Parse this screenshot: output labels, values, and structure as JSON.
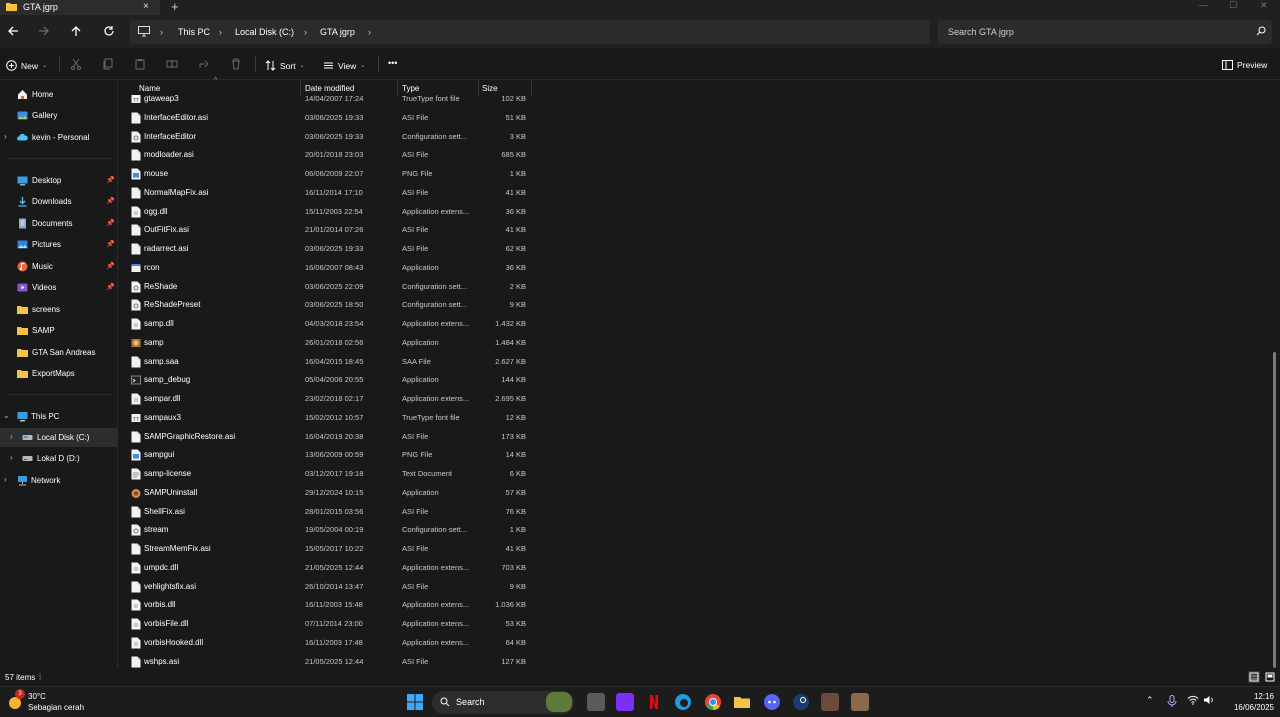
{
  "tab": {
    "title": "GTA jgrp",
    "close_glyph": "×",
    "new_tab_glyph": "+"
  },
  "window_controls": {
    "minimize": "—",
    "maximize": "☐",
    "close": "✕"
  },
  "breadcrumb": [
    "This PC",
    "Local Disk (C:)",
    "GTA jgrp"
  ],
  "search": {
    "placeholder": "Search GTA jgrp"
  },
  "commands": {
    "new": "New",
    "sort": "Sort",
    "view": "View",
    "more": "•••",
    "preview": "Preview"
  },
  "sidebar": {
    "quick": [
      {
        "label": "Home",
        "icon": "home-icon"
      },
      {
        "label": "Gallery",
        "icon": "gallery-icon"
      },
      {
        "label": "kevin - Personal",
        "icon": "onedrive-icon"
      }
    ],
    "pinned": [
      {
        "label": "Desktop",
        "icon": "desktop-folder-icon",
        "pinned": true
      },
      {
        "label": "Downloads",
        "icon": "downloads-icon",
        "pinned": true
      },
      {
        "label": "Documents",
        "icon": "documents-icon",
        "pinned": true
      },
      {
        "label": "Pictures",
        "icon": "pictures-icon",
        "pinned": true
      },
      {
        "label": "Music",
        "icon": "music-icon",
        "pinned": true
      },
      {
        "label": "Videos",
        "icon": "videos-icon",
        "pinned": true
      },
      {
        "label": "screens",
        "icon": "folder-icon",
        "pinned": false
      },
      {
        "label": "SAMP",
        "icon": "folder-icon",
        "pinned": false
      },
      {
        "label": "GTA San Andreas",
        "icon": "folder-icon",
        "pinned": false
      },
      {
        "label": "ExportMaps",
        "icon": "folder-icon",
        "pinned": false
      }
    ],
    "tree": [
      {
        "label": "This PC",
        "icon": "pc-icon",
        "expanded": true
      },
      {
        "label": "Local Disk (C:)",
        "icon": "drive-icon",
        "selected": true
      },
      {
        "label": "Lokal D (D:)",
        "icon": "drive-icon"
      },
      {
        "label": "Network",
        "icon": "network-icon"
      }
    ]
  },
  "columns": {
    "name": "Name",
    "date": "Date modified",
    "type": "Type",
    "size": "Size"
  },
  "files": [
    {
      "name": "gtaweap3",
      "date": "14/04/2007 17:24",
      "type": "TrueType font file",
      "size": "102 KB",
      "icon": "font-file-icon"
    },
    {
      "name": "InterfaceEditor.asi",
      "date": "03/06/2025 19:33",
      "type": "ASI File",
      "size": "51 KB",
      "icon": "file-icon"
    },
    {
      "name": "InterfaceEditor",
      "date": "03/06/2025 19:33",
      "type": "Configuration sett...",
      "size": "3 KB",
      "icon": "config-file-icon"
    },
    {
      "name": "modloader.asi",
      "date": "20/01/2018 23:03",
      "type": "ASI File",
      "size": "685 KB",
      "icon": "file-icon"
    },
    {
      "name": "mouse",
      "date": "06/06/2009 22:07",
      "type": "PNG File",
      "size": "1 KB",
      "icon": "image-file-icon"
    },
    {
      "name": "NormalMapFix.asi",
      "date": "16/11/2014 17:10",
      "type": "ASI File",
      "size": "41 KB",
      "icon": "file-icon"
    },
    {
      "name": "ogg.dll",
      "date": "15/11/2003 22:54",
      "type": "Application extens...",
      "size": "36 KB",
      "icon": "dll-file-icon"
    },
    {
      "name": "OutFitFix.asi",
      "date": "21/01/2014 07:26",
      "type": "ASI File",
      "size": "41 KB",
      "icon": "file-icon"
    },
    {
      "name": "radarrect.asi",
      "date": "03/06/2025 19:33",
      "type": "ASI File",
      "size": "62 KB",
      "icon": "file-icon"
    },
    {
      "name": "rcon",
      "date": "16/06/2007 08:43",
      "type": "Application",
      "size": "36 KB",
      "icon": "app-icon"
    },
    {
      "name": "ReShade",
      "date": "03/06/2025 22:09",
      "type": "Configuration sett...",
      "size": "2 KB",
      "icon": "config-file-icon"
    },
    {
      "name": "ReShadePreset",
      "date": "03/06/2025 18:50",
      "type": "Configuration sett...",
      "size": "9 KB",
      "icon": "config-file-icon"
    },
    {
      "name": "samp.dll",
      "date": "04/03/2018 23:54",
      "type": "Application extens...",
      "size": "1.432 KB",
      "icon": "dll-file-icon"
    },
    {
      "name": "samp",
      "date": "26/01/2018 02:56",
      "type": "Application",
      "size": "1.484 KB",
      "icon": "samp-app-icon"
    },
    {
      "name": "samp.saa",
      "date": "16/04/2015 18:45",
      "type": "SAA File",
      "size": "2.627 KB",
      "icon": "file-icon"
    },
    {
      "name": "samp_debug",
      "date": "05/04/2006 20:55",
      "type": "Application",
      "size": "144 KB",
      "icon": "console-app-icon"
    },
    {
      "name": "sampar.dll",
      "date": "23/02/2018 02:17",
      "type": "Application extens...",
      "size": "2.695 KB",
      "icon": "dll-file-icon"
    },
    {
      "name": "sampaux3",
      "date": "15/02/2012 10:57",
      "type": "TrueType font file",
      "size": "12 KB",
      "icon": "font-file-icon"
    },
    {
      "name": "SAMPGraphicRestore.asi",
      "date": "16/04/2019 20:38",
      "type": "ASI File",
      "size": "173 KB",
      "icon": "file-icon"
    },
    {
      "name": "sampgui",
      "date": "13/06/2009 00:59",
      "type": "PNG File",
      "size": "14 KB",
      "icon": "image-file-icon"
    },
    {
      "name": "samp-license",
      "date": "03/12/2017 19:18",
      "type": "Text Document",
      "size": "6 KB",
      "icon": "text-file-icon"
    },
    {
      "name": "SAMPUninstall",
      "date": "29/12/2024 10:15",
      "type": "Application",
      "size": "57 KB",
      "icon": "uninstall-app-icon"
    },
    {
      "name": "ShellFix.asi",
      "date": "28/01/2015 03:56",
      "type": "ASI File",
      "size": "76 KB",
      "icon": "file-icon"
    },
    {
      "name": "stream",
      "date": "19/05/2004 00:19",
      "type": "Configuration sett...",
      "size": "1 KB",
      "icon": "config-file-icon"
    },
    {
      "name": "StreamMemFix.asi",
      "date": "15/05/2017 10:22",
      "type": "ASI File",
      "size": "41 KB",
      "icon": "file-icon"
    },
    {
      "name": "umpdc.dll",
      "date": "21/05/2025 12:44",
      "type": "Application extens...",
      "size": "703 KB",
      "icon": "dll-file-icon"
    },
    {
      "name": "vehlightsfix.asi",
      "date": "26/10/2014 13:47",
      "type": "ASI File",
      "size": "9 KB",
      "icon": "file-icon"
    },
    {
      "name": "vorbis.dll",
      "date": "16/11/2003 15:48",
      "type": "Application extens...",
      "size": "1.036 KB",
      "icon": "dll-file-icon"
    },
    {
      "name": "vorbisFile.dll",
      "date": "07/11/2014 23:00",
      "type": "Application extens...",
      "size": "53 KB",
      "icon": "dll-file-icon"
    },
    {
      "name": "vorbisHooked.dll",
      "date": "16/11/2003 17:48",
      "type": "Application extens...",
      "size": "64 KB",
      "icon": "dll-file-icon"
    },
    {
      "name": "wshps.asi",
      "date": "21/05/2025 12:44",
      "type": "ASI File",
      "size": "127 KB",
      "icon": "file-icon"
    }
  ],
  "status": {
    "items": "57 items",
    "separator": "|"
  },
  "taskbar": {
    "weather_temp": "30°C",
    "weather_desc": "Sebagian cerah",
    "weather_badge": "3",
    "search_label": "Search",
    "time": "12:16",
    "date": "16/06/2025"
  },
  "colors": {
    "accent": "#4cc2ff",
    "folder": "#f5c542",
    "background": "#191919",
    "selected": "#2d2d2d"
  }
}
